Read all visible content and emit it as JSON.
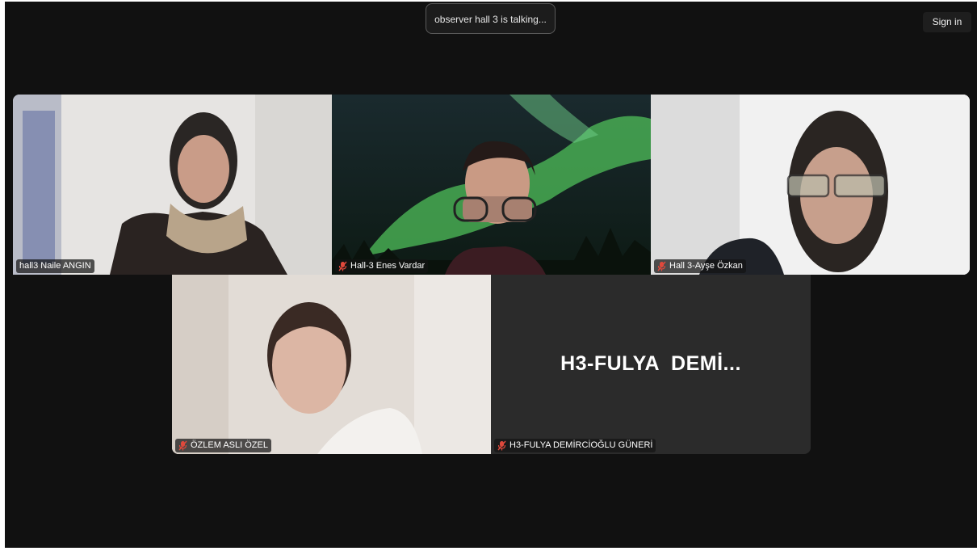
{
  "status_banner": {
    "text": "observer hall 3 is talking..."
  },
  "header": {
    "sign_in_label": "Sign in"
  },
  "participants": [
    {
      "name": "hall3 Naile ANGIN",
      "muted": false
    },
    {
      "name": "Hall-3 Enes Vardar",
      "muted": true
    },
    {
      "name": "Hall 3-Ayşe Özkan",
      "muted": true
    },
    {
      "name": "ÖZLEM ASLI ÖZEL",
      "muted": true
    },
    {
      "name": "H3-FULYA DEMİRCİOĞLU GÜNERİ",
      "muted": true,
      "video_off_label": "H3-FULYA  DEMİ..."
    }
  ],
  "colors": {
    "background": "#111111",
    "muted_icon": "#e0493c",
    "tile_off": "#2b2b2b"
  }
}
